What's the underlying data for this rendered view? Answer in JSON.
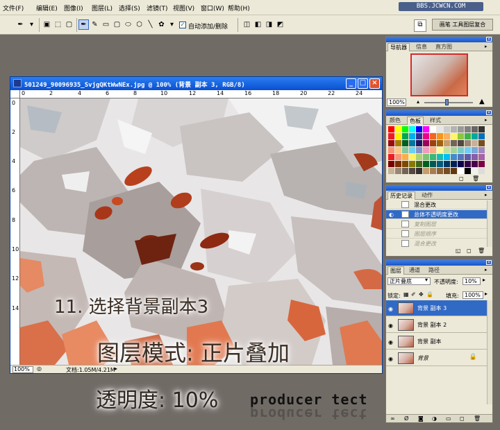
{
  "app": {
    "menus": [
      "文件(F)",
      "编辑(E)",
      "图像(I)",
      "图层(L)",
      "选择(S)",
      "滤镜(T)",
      "视图(V)",
      "窗口(W)",
      "帮助(H)"
    ],
    "watermark_site": "BBS.JCWCN.COM"
  },
  "options_bar": {
    "auto_add_label": "自动添加/删除",
    "auto_add_checked": "✓",
    "well_label": "画笔 工具图层复合"
  },
  "document": {
    "title": "501249_90096935_SvjgQKtWwNEx.jpg @ 100% (背景 副本 3, RGB/8)",
    "ruler_h": [
      "0",
      "2",
      "4",
      "6",
      "8",
      "10",
      "12",
      "14",
      "16",
      "18",
      "20",
      "22",
      "24"
    ],
    "ruler_v": [
      "0",
      "2",
      "4",
      "6",
      "8",
      "10",
      "12",
      "14"
    ],
    "zoom": "100%",
    "doc_info": "文档:1.05M/4.21M",
    "window_buttons": [
      "_",
      "□",
      "×"
    ]
  },
  "overlay": {
    "step": "11. 选择背景副本3",
    "mode": "图层模式: 正片叠加",
    "opacity": "透明度: 10%",
    "producer": "producer tect"
  },
  "navigator": {
    "tabs": [
      "导航器",
      "信息",
      "直方图"
    ],
    "zoom": "100%"
  },
  "color_panel": {
    "tabs": [
      "颜色",
      "色板",
      "样式"
    ],
    "swatch_colors": [
      "#ff0000",
      "#ffff00",
      "#00ff00",
      "#00ffff",
      "#0000ff",
      "#ff00ff",
      "#ffffff",
      "#e6e6e6",
      "#cccccc",
      "#b3b3b3",
      "#999999",
      "#808080",
      "#666666",
      "#333333",
      "#ed1c24",
      "#fff200",
      "#00a651",
      "#00aeef",
      "#2e3192",
      "#ec008c",
      "#f26522",
      "#f7941d",
      "#fbaf5d",
      "#fff568",
      "#8dc63f",
      "#39b54a",
      "#00a99d",
      "#0072bc",
      "#9e0b0f",
      "#a67c00",
      "#005e20",
      "#0076a3",
      "#1b1464",
      "#9e005d",
      "#a0410d",
      "#a36209",
      "#c69c6d",
      "#736357",
      "#534741",
      "#998675",
      "#c7b299",
      "#754c24",
      "#f69679",
      "#fdc689",
      "#82ca9c",
      "#6dcff6",
      "#8393ca",
      "#f49ac1",
      "#f9ad81",
      "#fff799",
      "#c4df9b",
      "#a3d39c",
      "#7accc8",
      "#6dcff6",
      "#7da7d9",
      "#a187be",
      "#ee1d24",
      "#f7977a",
      "#fbad4a",
      "#fff467",
      "#acd372",
      "#7cc576",
      "#3bb878",
      "#1abbb4",
      "#00bff3",
      "#438ccb",
      "#5574b9",
      "#605ca9",
      "#855fa8",
      "#a763a9",
      "#790000",
      "#7b2e00",
      "#7d4900",
      "#827b00",
      "#406618",
      "#005e20",
      "#005952",
      "#005b7f",
      "#003663",
      "#002157",
      "#0d004c",
      "#32004b",
      "#4b0049",
      "#7b0046",
      "#c7b299",
      "#998675",
      "#736357",
      "#534741",
      "#362f2d",
      "#c69c6d",
      "#a67c52",
      "#8c6239",
      "#754c24",
      "#603913",
      "#ffffff",
      "#000000",
      "#f0f0f0",
      "#dcdcdc"
    ]
  },
  "history": {
    "tabs": [
      "历史记录",
      "动作"
    ],
    "items": [
      {
        "label": "混合更改",
        "state": "normal"
      },
      {
        "label": "总体不透明度更改",
        "state": "selected"
      },
      {
        "label": "复制图层",
        "state": "dim"
      },
      {
        "label": "图层顺序",
        "state": "dim"
      },
      {
        "label": "混合更改",
        "state": "dim"
      }
    ]
  },
  "layers": {
    "tabs": [
      "图层",
      "通道",
      "路径"
    ],
    "blend_mode": "正片叠底",
    "opacity_label": "不透明度:",
    "opacity_value": "10%",
    "lock_label": "锁定:",
    "fill_label": "填充:",
    "fill_value": "100%",
    "items": [
      {
        "name": "背景 副本 3",
        "selected": true,
        "locked": false
      },
      {
        "name": "背景 副本 2",
        "selected": false,
        "locked": false
      },
      {
        "name": "背景 副本",
        "selected": false,
        "locked": false
      },
      {
        "name": "背景",
        "selected": false,
        "locked": true
      }
    ]
  }
}
